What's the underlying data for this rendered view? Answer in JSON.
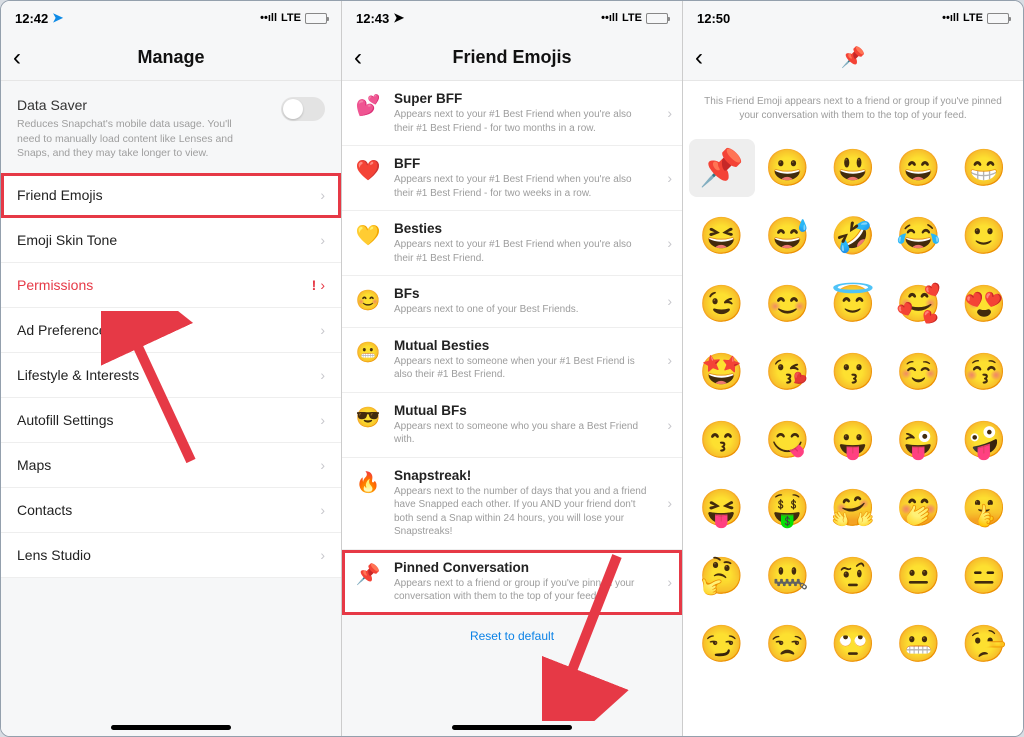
{
  "screen1": {
    "status": {
      "time": "12:42",
      "network": "LTE"
    },
    "title": "Manage",
    "data_saver": {
      "title": "Data Saver",
      "desc": "Reduces Snapchat's mobile data usage. You'll need to manually load content like Lenses and Snaps, and they may take longer to view."
    },
    "items": [
      "Friend Emojis",
      "Emoji Skin Tone",
      "Permissions",
      "Ad Preferences",
      "Lifestyle & Interests",
      "Autofill Settings",
      "Maps",
      "Contacts",
      "Lens Studio"
    ]
  },
  "screen2": {
    "status": {
      "time": "12:43",
      "network": "LTE"
    },
    "title": "Friend Emojis",
    "items": [
      {
        "emoji": "💕",
        "title": "Super BFF",
        "desc": "Appears next to your #1 Best Friend when you're also their #1 Best Friend - for two months in a row."
      },
      {
        "emoji": "❤️",
        "title": "BFF",
        "desc": "Appears next to your #1 Best Friend when you're also their #1 Best Friend - for two weeks in a row."
      },
      {
        "emoji": "💛",
        "title": "Besties",
        "desc": "Appears next to your #1 Best Friend when you're also their #1 Best Friend."
      },
      {
        "emoji": "😊",
        "title": "BFs",
        "desc": "Appears next to one of your Best Friends."
      },
      {
        "emoji": "😬",
        "title": "Mutual Besties",
        "desc": "Appears next to someone when your #1 Best Friend is also their #1 Best Friend."
      },
      {
        "emoji": "😎",
        "title": "Mutual BFs",
        "desc": "Appears next to someone who you share a Best Friend with."
      },
      {
        "emoji": "🔥",
        "title": "Snapstreak!",
        "desc": "Appears next to the number of days that you and a friend have Snapped each other. If you AND your friend don't both send a Snap within 24 hours, you will lose your Snapstreaks!"
      },
      {
        "emoji": "📌",
        "title": "Pinned Conversation",
        "desc": "Appears next to a friend or group if you've pinned your conversation with them to the top of your feed."
      }
    ],
    "reset": "Reset to default"
  },
  "screen3": {
    "status": {
      "time": "12:50",
      "network": "LTE"
    },
    "header_emoji": "📌",
    "desc": "This Friend Emoji appears next to a friend or group if you've pinned your conversation with them to the top of your feed.",
    "emojis": [
      "📌",
      "😀",
      "😃",
      "😄",
      "😁",
      "😆",
      "😅",
      "🤣",
      "😂",
      "🙂",
      "😉",
      "😊",
      "😇",
      "🥰",
      "😍",
      "🤩",
      "😘",
      "😗",
      "☺️",
      "😚",
      "😙",
      "😋",
      "😛",
      "😜",
      "🤪",
      "😝",
      "🤑",
      "🤗",
      "🤭",
      "🤫",
      "🤔",
      "🤐",
      "🤨",
      "😐",
      "😑",
      "😏",
      "😒",
      "🙄",
      "😬",
      "🤥"
    ]
  }
}
